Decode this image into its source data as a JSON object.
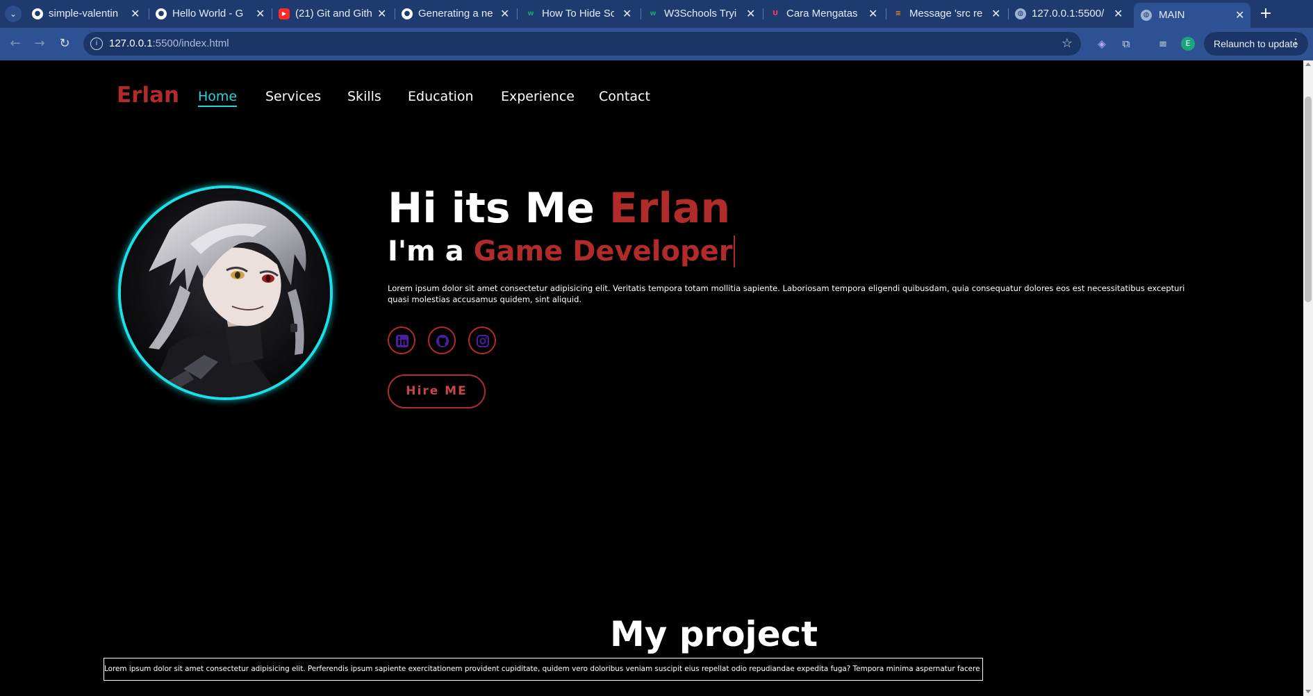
{
  "browser": {
    "tabs": [
      {
        "title": "simple-valentin",
        "icon": "github-icon"
      },
      {
        "title": "Hello World - G",
        "icon": "github-icon"
      },
      {
        "title": "(21) Git and Gith",
        "icon": "youtube-icon"
      },
      {
        "title": "Generating a ne",
        "icon": "github-icon"
      },
      {
        "title": "How To Hide Sc",
        "icon": "w3schools-icon"
      },
      {
        "title": "W3Schools Tryi",
        "icon": "w3schools-icon"
      },
      {
        "title": "Cara Mengatas",
        "icon": "magnet-icon"
      },
      {
        "title": "Message 'src re",
        "icon": "stackoverflow-icon"
      },
      {
        "title": "127.0.0.1:5500/",
        "icon": "globe-icon"
      },
      {
        "title": "MAIN",
        "icon": "globe-icon",
        "active": true
      }
    ],
    "url_host": "127.0.0.1",
    "url_path": ":5500/index.html",
    "relaunch_label": "Relaunch to update",
    "profile_initial": "E"
  },
  "page": {
    "brand": "Erlan",
    "nav": [
      "Home",
      "Services",
      "Skills",
      "Education",
      "Experience",
      "Contact"
    ],
    "active_nav": "Home",
    "hero": {
      "greeting": "Hi its Me ",
      "name": "Erlan",
      "role_prefix": "I'm a ",
      "role": "Game Developer",
      "description": "Lorem ipsum dolor sit amet consectetur adipisicing elit. Veritatis tempora totam mollitia sapiente. Laboriosam tempora eligendi quibusdam, quia consequatur dolores eos est necessitatibus excepturi quasi molestias accusamus quidem, sint aliquid.",
      "social": [
        {
          "name": "linkedin-icon"
        },
        {
          "name": "github-icon"
        },
        {
          "name": "instagram-icon"
        }
      ],
      "hire_button": "Hire ME"
    },
    "projects": {
      "title": "My project",
      "description": "Lorem ipsum dolor sit amet consectetur adipisicing elit. Perferendis ipsum sapiente exercitationem provident cupiditate, quidem vero doloribus veniam suscipit eius repellat odio repudiandae expedita fuga? Tempora minima aspernatur facere dolorum?"
    }
  },
  "colors": {
    "accent_red": "#b22b2b",
    "accent_cyan": "#1fd8e0",
    "social_icon_purple": "#4b1fa3",
    "chrome_blue": "#2e5194"
  }
}
